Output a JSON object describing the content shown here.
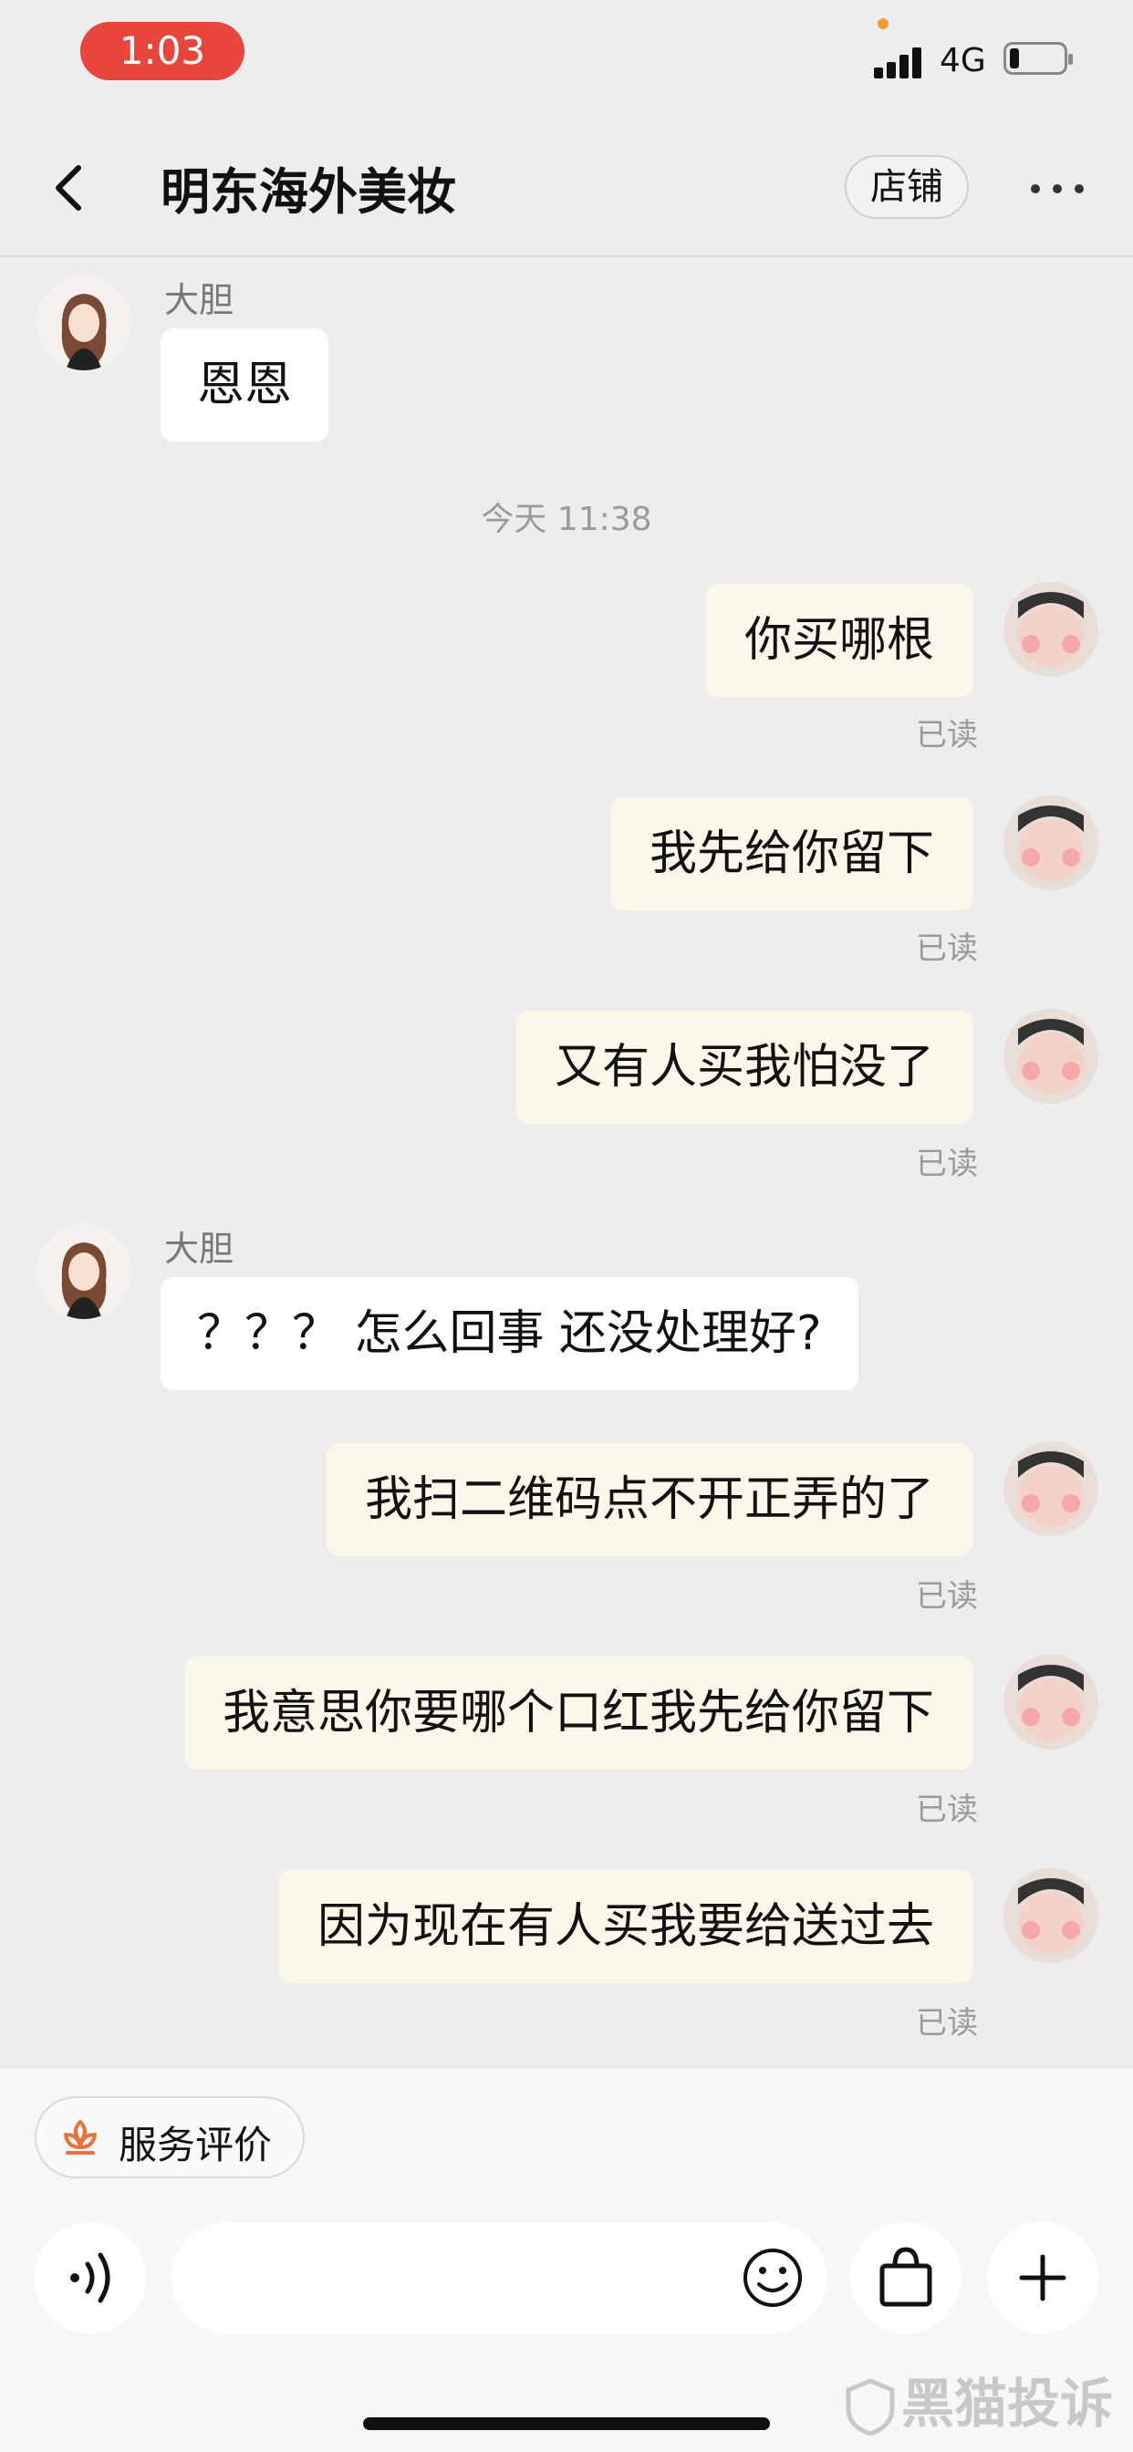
{
  "status_bar": {
    "time": "1:03",
    "network": "4G"
  },
  "nav": {
    "title": "明东海外美妆",
    "shop_label": "店铺"
  },
  "messages": {
    "m1": {
      "sender": "大胆",
      "text": "恩恩"
    },
    "timestamp": "今天 11:38",
    "m2": {
      "text": "你买哪根",
      "status": "已读"
    },
    "m3": {
      "text": "我先给你留下",
      "status": "已读"
    },
    "m4": {
      "text": "又有人买我怕没了",
      "status": "已读"
    },
    "m5": {
      "sender": "大胆",
      "text": "？？？ 怎么回事 还没处理好?"
    },
    "m6": {
      "text": "我扫二维码点不开正弄的了",
      "status": "已读"
    },
    "m7": {
      "text": "我意思你要哪个口红我先给你留下",
      "status": "已读"
    },
    "m8": {
      "text": "因为现在有人买我要给送过去",
      "status": "已读"
    }
  },
  "bottom": {
    "service_label": "服务评价",
    "input_placeholder": "",
    "watermark": "黑猫投诉"
  },
  "colors": {
    "accent_red": "#e8453c",
    "outgoing_bubble": "#fcf8e9",
    "incoming_bubble": "#ffffff",
    "background": "#ededed",
    "service_icon": "#e8713c"
  },
  "icons": [
    "back-icon",
    "more-icon",
    "voice-icon",
    "emoji-icon",
    "shopping-bag-icon",
    "plus-icon",
    "service-flower-icon"
  ]
}
